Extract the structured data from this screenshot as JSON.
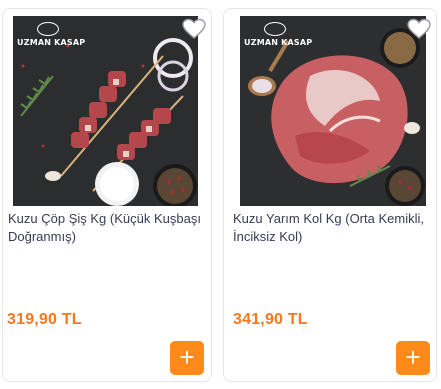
{
  "products": [
    {
      "logo_text": "UZMAN KASAP",
      "name": "Kuzu Çöp Şiş Kg (Küçük Kuşbaşı Doğranmış)",
      "price": "319,90 TL",
      "favorite_icon": "heart-outline",
      "add_icon": "plus"
    },
    {
      "logo_text": "UZMAN KASAP",
      "name": "Kuzu Yarım Kol Kg (Orta Kemikli, İnciksiz Kol)",
      "price": "341,90 TL",
      "favorite_icon": "heart-outline",
      "add_icon": "plus"
    }
  ],
  "colors": {
    "price": "#f7781d",
    "add_button": "#ff8a1a",
    "title": "#3a3a55"
  }
}
